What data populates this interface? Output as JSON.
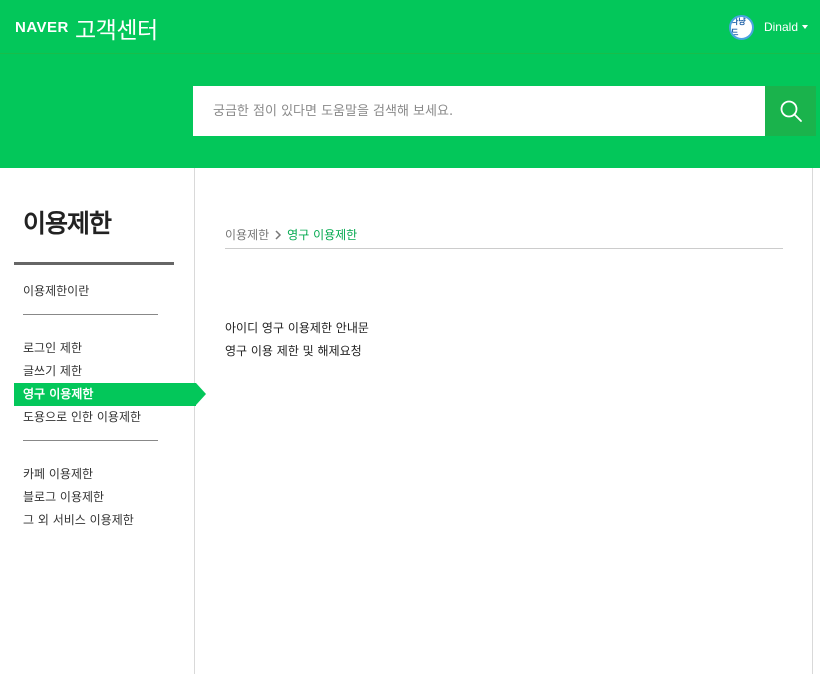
{
  "header": {
    "brand": "NAVER",
    "service_title": "고객센터",
    "user": {
      "avatar_text": "다냥드",
      "name": "Dinald"
    }
  },
  "search": {
    "placeholder": "궁금한 점이 있다면 도움말을 검색해 보세요."
  },
  "sidebar": {
    "title": "이용제한",
    "items": [
      {
        "type": "item",
        "label": "이용제한이란"
      },
      {
        "type": "separator"
      },
      {
        "type": "item",
        "label": "로그인 제한"
      },
      {
        "type": "item",
        "label": "글쓰기 제한"
      },
      {
        "type": "item",
        "label": "영구 이용제한",
        "active": true
      },
      {
        "type": "item",
        "label": "도용으로 인한 이용제한"
      },
      {
        "type": "separator"
      },
      {
        "type": "item",
        "label": "카페 이용제한"
      },
      {
        "type": "item",
        "label": "블로그 이용제한"
      },
      {
        "type": "item",
        "label": "그 외 서비스 이용제한"
      }
    ]
  },
  "main": {
    "breadcrumb": {
      "root": "이용제한",
      "current": "영구 이용제한"
    },
    "links": [
      "아이디 영구 이용제한 안내문",
      "영구 이용 제한 및 해제요청"
    ]
  },
  "colors": {
    "brand_green": "#03c75a",
    "search_button": "#1ab34c",
    "breadcrumb_active": "#03a94f"
  }
}
